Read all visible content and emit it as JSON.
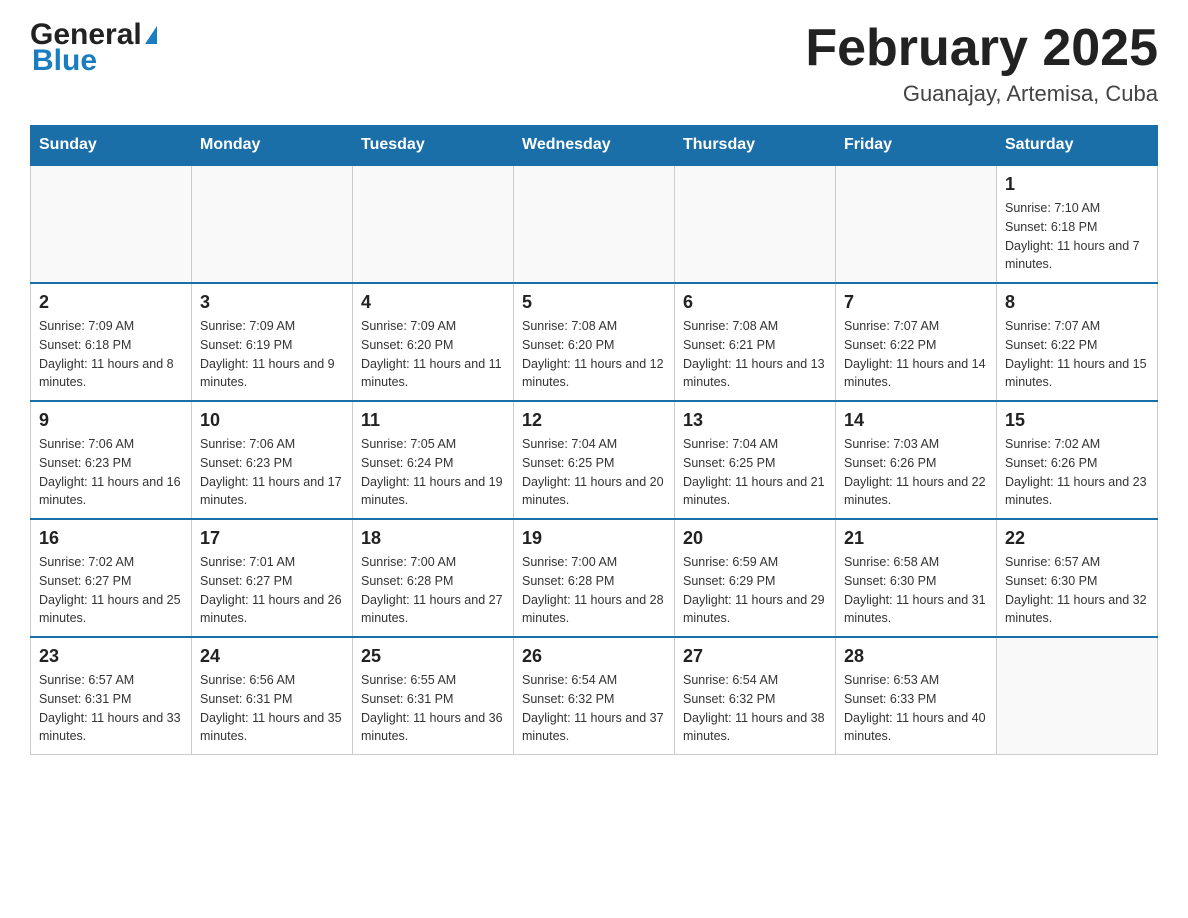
{
  "header": {
    "logo_general": "General",
    "logo_blue": "Blue",
    "title": "February 2025",
    "location": "Guanajay, Artemisa, Cuba"
  },
  "calendar": {
    "days_of_week": [
      "Sunday",
      "Monday",
      "Tuesday",
      "Wednesday",
      "Thursday",
      "Friday",
      "Saturday"
    ],
    "weeks": [
      [
        {
          "day": "",
          "sunrise": "",
          "sunset": "",
          "daylight": "",
          "empty": true
        },
        {
          "day": "",
          "sunrise": "",
          "sunset": "",
          "daylight": "",
          "empty": true
        },
        {
          "day": "",
          "sunrise": "",
          "sunset": "",
          "daylight": "",
          "empty": true
        },
        {
          "day": "",
          "sunrise": "",
          "sunset": "",
          "daylight": "",
          "empty": true
        },
        {
          "day": "",
          "sunrise": "",
          "sunset": "",
          "daylight": "",
          "empty": true
        },
        {
          "day": "",
          "sunrise": "",
          "sunset": "",
          "daylight": "",
          "empty": true
        },
        {
          "day": "1",
          "sunrise": "Sunrise: 7:10 AM",
          "sunset": "Sunset: 6:18 PM",
          "daylight": "Daylight: 11 hours and 7 minutes.",
          "empty": false
        }
      ],
      [
        {
          "day": "2",
          "sunrise": "Sunrise: 7:09 AM",
          "sunset": "Sunset: 6:18 PM",
          "daylight": "Daylight: 11 hours and 8 minutes.",
          "empty": false
        },
        {
          "day": "3",
          "sunrise": "Sunrise: 7:09 AM",
          "sunset": "Sunset: 6:19 PM",
          "daylight": "Daylight: 11 hours and 9 minutes.",
          "empty": false
        },
        {
          "day": "4",
          "sunrise": "Sunrise: 7:09 AM",
          "sunset": "Sunset: 6:20 PM",
          "daylight": "Daylight: 11 hours and 11 minutes.",
          "empty": false
        },
        {
          "day": "5",
          "sunrise": "Sunrise: 7:08 AM",
          "sunset": "Sunset: 6:20 PM",
          "daylight": "Daylight: 11 hours and 12 minutes.",
          "empty": false
        },
        {
          "day": "6",
          "sunrise": "Sunrise: 7:08 AM",
          "sunset": "Sunset: 6:21 PM",
          "daylight": "Daylight: 11 hours and 13 minutes.",
          "empty": false
        },
        {
          "day": "7",
          "sunrise": "Sunrise: 7:07 AM",
          "sunset": "Sunset: 6:22 PM",
          "daylight": "Daylight: 11 hours and 14 minutes.",
          "empty": false
        },
        {
          "day": "8",
          "sunrise": "Sunrise: 7:07 AM",
          "sunset": "Sunset: 6:22 PM",
          "daylight": "Daylight: 11 hours and 15 minutes.",
          "empty": false
        }
      ],
      [
        {
          "day": "9",
          "sunrise": "Sunrise: 7:06 AM",
          "sunset": "Sunset: 6:23 PM",
          "daylight": "Daylight: 11 hours and 16 minutes.",
          "empty": false
        },
        {
          "day": "10",
          "sunrise": "Sunrise: 7:06 AM",
          "sunset": "Sunset: 6:23 PM",
          "daylight": "Daylight: 11 hours and 17 minutes.",
          "empty": false
        },
        {
          "day": "11",
          "sunrise": "Sunrise: 7:05 AM",
          "sunset": "Sunset: 6:24 PM",
          "daylight": "Daylight: 11 hours and 19 minutes.",
          "empty": false
        },
        {
          "day": "12",
          "sunrise": "Sunrise: 7:04 AM",
          "sunset": "Sunset: 6:25 PM",
          "daylight": "Daylight: 11 hours and 20 minutes.",
          "empty": false
        },
        {
          "day": "13",
          "sunrise": "Sunrise: 7:04 AM",
          "sunset": "Sunset: 6:25 PM",
          "daylight": "Daylight: 11 hours and 21 minutes.",
          "empty": false
        },
        {
          "day": "14",
          "sunrise": "Sunrise: 7:03 AM",
          "sunset": "Sunset: 6:26 PM",
          "daylight": "Daylight: 11 hours and 22 minutes.",
          "empty": false
        },
        {
          "day": "15",
          "sunrise": "Sunrise: 7:02 AM",
          "sunset": "Sunset: 6:26 PM",
          "daylight": "Daylight: 11 hours and 23 minutes.",
          "empty": false
        }
      ],
      [
        {
          "day": "16",
          "sunrise": "Sunrise: 7:02 AM",
          "sunset": "Sunset: 6:27 PM",
          "daylight": "Daylight: 11 hours and 25 minutes.",
          "empty": false
        },
        {
          "day": "17",
          "sunrise": "Sunrise: 7:01 AM",
          "sunset": "Sunset: 6:27 PM",
          "daylight": "Daylight: 11 hours and 26 minutes.",
          "empty": false
        },
        {
          "day": "18",
          "sunrise": "Sunrise: 7:00 AM",
          "sunset": "Sunset: 6:28 PM",
          "daylight": "Daylight: 11 hours and 27 minutes.",
          "empty": false
        },
        {
          "day": "19",
          "sunrise": "Sunrise: 7:00 AM",
          "sunset": "Sunset: 6:28 PM",
          "daylight": "Daylight: 11 hours and 28 minutes.",
          "empty": false
        },
        {
          "day": "20",
          "sunrise": "Sunrise: 6:59 AM",
          "sunset": "Sunset: 6:29 PM",
          "daylight": "Daylight: 11 hours and 29 minutes.",
          "empty": false
        },
        {
          "day": "21",
          "sunrise": "Sunrise: 6:58 AM",
          "sunset": "Sunset: 6:30 PM",
          "daylight": "Daylight: 11 hours and 31 minutes.",
          "empty": false
        },
        {
          "day": "22",
          "sunrise": "Sunrise: 6:57 AM",
          "sunset": "Sunset: 6:30 PM",
          "daylight": "Daylight: 11 hours and 32 minutes.",
          "empty": false
        }
      ],
      [
        {
          "day": "23",
          "sunrise": "Sunrise: 6:57 AM",
          "sunset": "Sunset: 6:31 PM",
          "daylight": "Daylight: 11 hours and 33 minutes.",
          "empty": false
        },
        {
          "day": "24",
          "sunrise": "Sunrise: 6:56 AM",
          "sunset": "Sunset: 6:31 PM",
          "daylight": "Daylight: 11 hours and 35 minutes.",
          "empty": false
        },
        {
          "day": "25",
          "sunrise": "Sunrise: 6:55 AM",
          "sunset": "Sunset: 6:31 PM",
          "daylight": "Daylight: 11 hours and 36 minutes.",
          "empty": false
        },
        {
          "day": "26",
          "sunrise": "Sunrise: 6:54 AM",
          "sunset": "Sunset: 6:32 PM",
          "daylight": "Daylight: 11 hours and 37 minutes.",
          "empty": false
        },
        {
          "day": "27",
          "sunrise": "Sunrise: 6:54 AM",
          "sunset": "Sunset: 6:32 PM",
          "daylight": "Daylight: 11 hours and 38 minutes.",
          "empty": false
        },
        {
          "day": "28",
          "sunrise": "Sunrise: 6:53 AM",
          "sunset": "Sunset: 6:33 PM",
          "daylight": "Daylight: 11 hours and 40 minutes.",
          "empty": false
        },
        {
          "day": "",
          "sunrise": "",
          "sunset": "",
          "daylight": "",
          "empty": true
        }
      ]
    ]
  }
}
